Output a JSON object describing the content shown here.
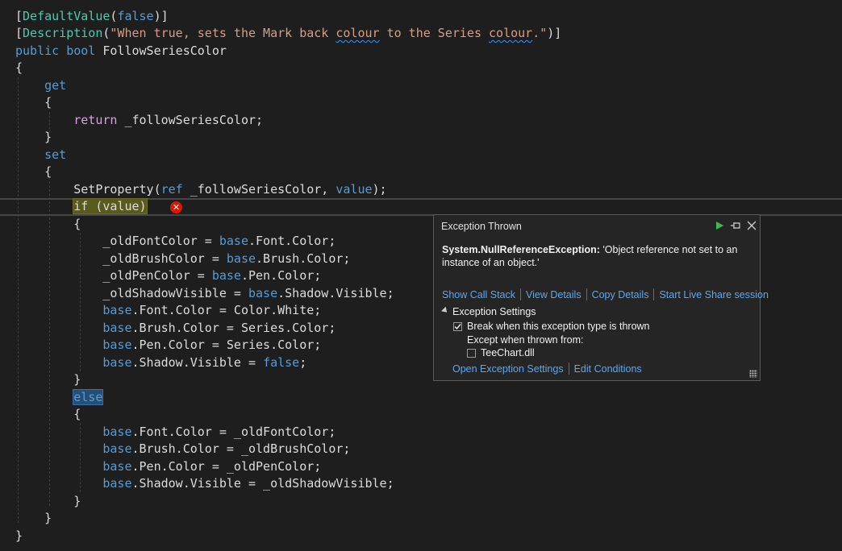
{
  "code": {
    "lines": [
      [
        {
          "t": "[",
          "c": "#dcdcdc"
        },
        {
          "t": "DefaultValue",
          "c": "#4ec9b0"
        },
        {
          "t": "(",
          "c": "#dcdcdc"
        },
        {
          "t": "false",
          "c": "#569cd6"
        },
        {
          "t": ")]",
          "c": "#dcdcdc"
        }
      ],
      [
        {
          "t": "[",
          "c": "#dcdcdc"
        },
        {
          "t": "Description",
          "c": "#4ec9b0"
        },
        {
          "t": "(",
          "c": "#dcdcdc"
        },
        {
          "t": "\"When true, sets the Mark back ",
          "c": "#d69d85"
        },
        {
          "t": "colour",
          "c": "#d69d85",
          "s": "squiggle"
        },
        {
          "t": " to the Series ",
          "c": "#d69d85"
        },
        {
          "t": "colour",
          "c": "#d69d85",
          "s": "squiggle"
        },
        {
          "t": ".\"",
          "c": "#d69d85"
        },
        {
          "t": ")]",
          "c": "#dcdcdc"
        }
      ],
      [
        {
          "t": "public bool ",
          "c": "#569cd6"
        },
        {
          "t": "FollowSeriesColor",
          "c": "#dcdcdc"
        }
      ],
      [
        {
          "t": "{",
          "c": "#dcdcdc"
        }
      ],
      [
        {
          "t": "    get",
          "c": "#569cd6"
        }
      ],
      [
        {
          "t": "    {",
          "c": "#dcdcdc"
        }
      ],
      [
        {
          "t": "        return ",
          "c": "#d8a0df"
        },
        {
          "t": "_followSeriesColor;",
          "c": "#dcdcdc"
        }
      ],
      [
        {
          "t": "    }",
          "c": "#dcdcdc"
        }
      ],
      [
        {
          "t": "    set",
          "c": "#569cd6"
        }
      ],
      [
        {
          "t": "    {",
          "c": "#dcdcdc"
        }
      ],
      [
        {
          "t": "        SetProperty(",
          "c": "#dcdcdc"
        },
        {
          "t": "ref ",
          "c": "#569cd6"
        },
        {
          "t": "_followSeriesColor, ",
          "c": "#dcdcdc"
        },
        {
          "t": "value",
          "c": "#569cd6"
        },
        {
          "t": ");",
          "c": "#dcdcdc"
        }
      ],
      [
        {
          "t": "        ",
          "c": "#dcdcdc"
        },
        {
          "t": "if (value)",
          "c": "#dcdcdc",
          "s": "hl-yellow"
        }
      ],
      [
        {
          "t": "        {",
          "c": "#dcdcdc"
        }
      ],
      [
        {
          "t": "            _oldFontColor = ",
          "c": "#dcdcdc"
        },
        {
          "t": "base",
          "c": "#569cd6"
        },
        {
          "t": ".Font.Color;",
          "c": "#dcdcdc"
        }
      ],
      [
        {
          "t": "            _oldBrushColor = ",
          "c": "#dcdcdc"
        },
        {
          "t": "base",
          "c": "#569cd6"
        },
        {
          "t": ".Brush.Color;",
          "c": "#dcdcdc"
        }
      ],
      [
        {
          "t": "            _oldPenColor = ",
          "c": "#dcdcdc"
        },
        {
          "t": "base",
          "c": "#569cd6"
        },
        {
          "t": ".Pen.Color;",
          "c": "#dcdcdc"
        }
      ],
      [
        {
          "t": "            _oldShadowVisible = ",
          "c": "#dcdcdc"
        },
        {
          "t": "base",
          "c": "#569cd6"
        },
        {
          "t": ".Shadow.Visible;",
          "c": "#dcdcdc"
        }
      ],
      [
        {
          "t": "            ",
          "c": "#dcdcdc"
        },
        {
          "t": "base",
          "c": "#569cd6"
        },
        {
          "t": ".Font.Color = Color.White;",
          "c": "#dcdcdc"
        }
      ],
      [
        {
          "t": "            ",
          "c": "#dcdcdc"
        },
        {
          "t": "base",
          "c": "#569cd6"
        },
        {
          "t": ".Brush.Color = Series.Color;",
          "c": "#dcdcdc"
        }
      ],
      [
        {
          "t": "            ",
          "c": "#dcdcdc"
        },
        {
          "t": "base",
          "c": "#569cd6"
        },
        {
          "t": ".Pen.Color = Series.Color;",
          "c": "#dcdcdc"
        }
      ],
      [
        {
          "t": "            ",
          "c": "#dcdcdc"
        },
        {
          "t": "base",
          "c": "#569cd6"
        },
        {
          "t": ".Shadow.Visible = ",
          "c": "#dcdcdc"
        },
        {
          "t": "false",
          "c": "#569cd6"
        },
        {
          "t": ";",
          "c": "#dcdcdc"
        }
      ],
      [
        {
          "t": "        }",
          "c": "#dcdcdc"
        }
      ],
      [
        {
          "t": "        ",
          "c": "#dcdcdc"
        },
        {
          "t": "else",
          "c": "#569cd6",
          "s": "hl-blue"
        }
      ],
      [
        {
          "t": "        {",
          "c": "#dcdcdc"
        }
      ],
      [
        {
          "t": "            ",
          "c": "#dcdcdc"
        },
        {
          "t": "base",
          "c": "#569cd6"
        },
        {
          "t": ".Font.Color = _oldFontColor;",
          "c": "#dcdcdc"
        }
      ],
      [
        {
          "t": "            ",
          "c": "#dcdcdc"
        },
        {
          "t": "base",
          "c": "#569cd6"
        },
        {
          "t": ".Brush.Color = _oldBrushColor;",
          "c": "#dcdcdc"
        }
      ],
      [
        {
          "t": "            ",
          "c": "#dcdcdc"
        },
        {
          "t": "base",
          "c": "#569cd6"
        },
        {
          "t": ".Pen.Color = _oldPenColor;",
          "c": "#dcdcdc"
        }
      ],
      [
        {
          "t": "            ",
          "c": "#dcdcdc"
        },
        {
          "t": "base",
          "c": "#569cd6"
        },
        {
          "t": ".Shadow.Visible = _oldShadowVisible;",
          "c": "#dcdcdc"
        }
      ],
      [
        {
          "t": "        }",
          "c": "#dcdcdc"
        }
      ],
      [
        {
          "t": "    }",
          "c": "#dcdcdc"
        }
      ],
      [
        {
          "t": "}",
          "c": "#dcdcdc"
        }
      ]
    ],
    "current_line_index": 11,
    "error_icon": "error-x-icon"
  },
  "exception": {
    "title": "Exception Thrown",
    "exception_type": "System.NullReferenceException:",
    "message": " 'Object reference not set to an instance of an object.'",
    "links": [
      "Show Call Stack",
      "View Details",
      "Copy Details",
      "Start Live Share session"
    ],
    "settings_header": "Exception Settings",
    "break_when_thrown_label": "Break when this exception type is thrown",
    "break_when_thrown_checked": true,
    "except_when_label": "Except when thrown from:",
    "teechart_label": "TeeChart.dll",
    "teechart_checked": false,
    "open_settings_link": "Open Exception Settings",
    "edit_conditions_link": "Edit Conditions",
    "icons": [
      "continue-icon",
      "pin-icon",
      "close-icon"
    ]
  },
  "colors": {
    "background": "#1e1e1e",
    "keyword": "#569cd6",
    "type": "#4ec9b0",
    "string": "#d69d85",
    "control": "#d8a0df",
    "link": "#57a8f5",
    "error": "#e51400"
  }
}
